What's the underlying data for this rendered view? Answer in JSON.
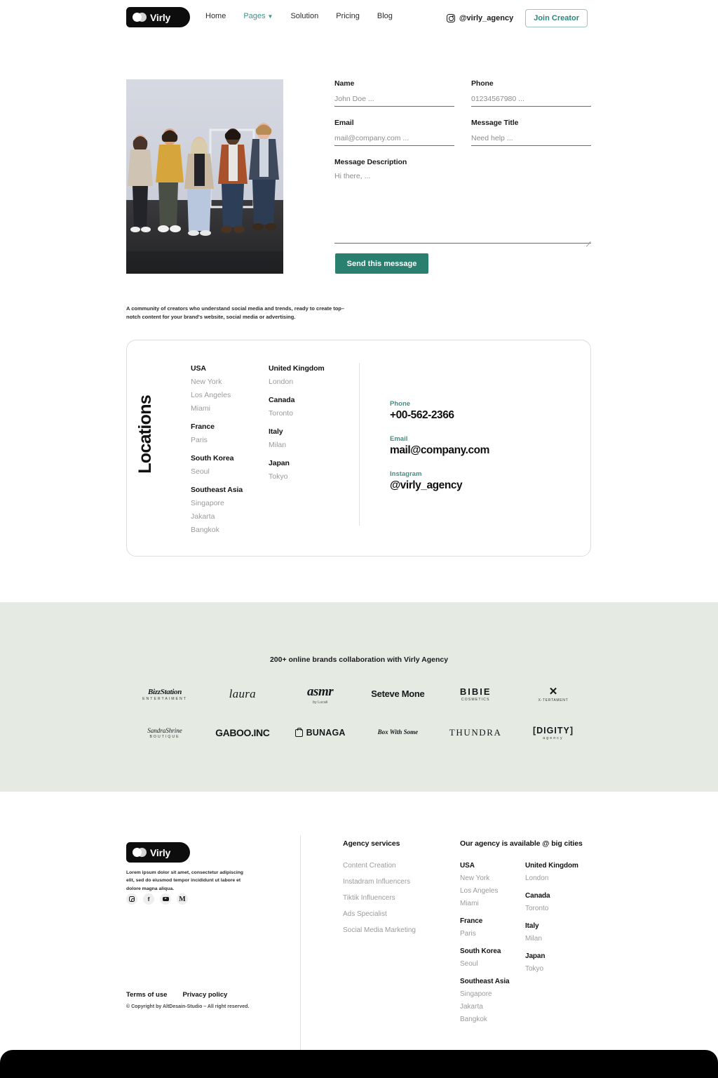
{
  "brand": {
    "name": "Virly"
  },
  "colors": {
    "teal": "#29806f",
    "teal_light": "#3d9287",
    "sage": "#e5ebe3",
    "black": "#0d0d0d"
  },
  "nav": {
    "links": [
      {
        "label": "Home",
        "active": false
      },
      {
        "label": "Pages",
        "active": true,
        "has_chevron": true
      },
      {
        "label": "Solution",
        "active": false
      },
      {
        "label": "Pricing",
        "active": false
      },
      {
        "label": "Blog",
        "active": false
      }
    ],
    "instagram_handle": "@virly_agency",
    "cta_label": "Join Creator"
  },
  "contact_form": {
    "fields": [
      {
        "label": "Name",
        "placeholder": "John Doe ..."
      },
      {
        "label": "Phone",
        "placeholder": "01234567980 ..."
      },
      {
        "label": "Email",
        "placeholder": "mail@company.com ..."
      },
      {
        "label": "Message Title",
        "placeholder": "Need help ..."
      }
    ],
    "message": {
      "label": "Message Description",
      "placeholder": "Hi there, ..."
    },
    "submit_label": "Send this message"
  },
  "blurb": "A community of creators who understand social media and trends, ready to create top–notch content for your brand's website, social media or advertising.",
  "locations_card": {
    "vertical_title": "Locations",
    "column_1": [
      {
        "country": "USA",
        "cities": [
          "New York",
          "Los Angeles",
          "Miami"
        ]
      },
      {
        "country": "France",
        "cities": [
          "Paris"
        ]
      },
      {
        "country": "South Korea",
        "cities": [
          "Seoul"
        ]
      },
      {
        "country": "Southeast Asia",
        "cities": [
          "Singapore",
          "Jakarta",
          "Bangkok"
        ]
      }
    ],
    "column_2": [
      {
        "country": "United Kingdom",
        "cities": [
          "London"
        ]
      },
      {
        "country": "Canada",
        "cities": [
          "Toronto"
        ]
      },
      {
        "country": "Italy",
        "cities": [
          "Milan"
        ]
      },
      {
        "country": "Japan",
        "cities": [
          "Tokyo"
        ]
      }
    ],
    "contacts": [
      {
        "label": "Phone",
        "value": "+00-562-2366"
      },
      {
        "label": "Email",
        "value": "mail@company.com"
      },
      {
        "label": "Instagram",
        "value": "@virly_agency"
      }
    ]
  },
  "brands_section": {
    "title": "200+ online brands collaboration with Virly Agency",
    "row_1": [
      {
        "name": "BizzStation",
        "sub": "ENTERTAIMENT"
      },
      {
        "name": "laura",
        "sub": ""
      },
      {
        "name": "asmr",
        "sub": "by Lucali"
      },
      {
        "name": "Seteve Mone",
        "sub": ""
      },
      {
        "name": "BIBIE",
        "sub": "COSMETICS"
      },
      {
        "name": "X-TERTAMENT",
        "sub": "X-TERTAMENT"
      }
    ],
    "row_2": [
      {
        "name": "SandraShrine",
        "sub": "BOUTIQUE"
      },
      {
        "name": "GABOO.INC",
        "sub": ""
      },
      {
        "name": "BUNAGA",
        "sub": ""
      },
      {
        "name": "Box With Some",
        "sub": ""
      },
      {
        "name": "THUNDRA",
        "sub": ""
      },
      {
        "name": "[DIGITY]",
        "sub": "agency"
      }
    ]
  },
  "footer": {
    "description": "Lorem ipsum dolor sit amet, consectetur adipiscing elit, sed do eiusmod tempor incididunt ut labore et dolore magna aliqua.",
    "socials": [
      "instagram-icon",
      "facebook-icon",
      "youtube-icon",
      "medium-icon"
    ],
    "services": {
      "heading": "Agency services",
      "items": [
        "Content Creation",
        "Instadram Influencers",
        "Tiktik Influencers",
        "Ads Specialist",
        "Social Media Marketing"
      ]
    },
    "cities": {
      "heading": "Our agency is available @ big cities",
      "column_1": [
        {
          "country": "USA",
          "cities": [
            "New York",
            "Los Angeles",
            "Miami"
          ]
        },
        {
          "country": "France",
          "cities": [
            "Paris"
          ]
        },
        {
          "country": "South Korea",
          "cities": [
            "Seoul"
          ]
        },
        {
          "country": "Southeast Asia",
          "cities": [
            "Singapore",
            "Jakarta",
            "Bangkok"
          ]
        }
      ],
      "column_2": [
        {
          "country": "United Kingdom",
          "cities": [
            "London"
          ]
        },
        {
          "country": "Canada",
          "cities": [
            "Toronto"
          ]
        },
        {
          "country": "Italy",
          "cities": [
            "Milan"
          ]
        },
        {
          "country": "Japan",
          "cities": [
            "Tokyo"
          ]
        }
      ]
    },
    "legal": [
      "Terms of use",
      "Privacy policy"
    ],
    "copyright": "© Copyright by AltDesain-Studio – All right reserved."
  }
}
